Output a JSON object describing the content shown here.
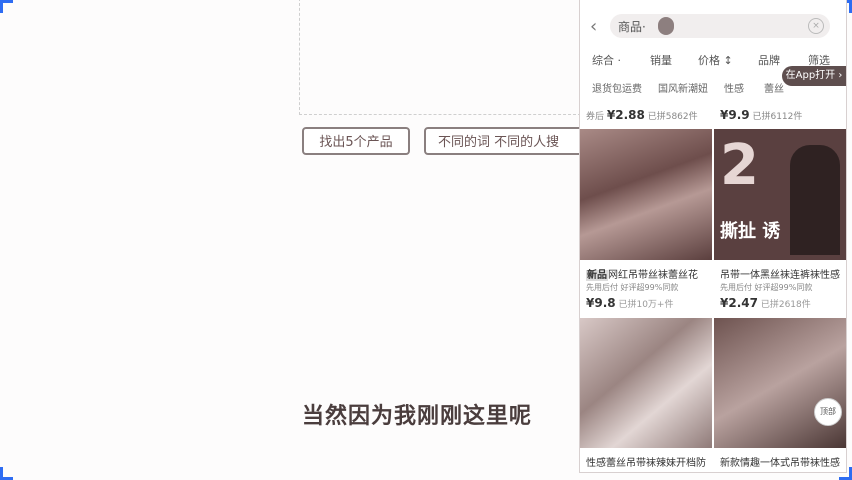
{
  "tags": {
    "t1": "找出5个产品",
    "t2": "不同的词 不同的人搜"
  },
  "subtitle": "当然因为我刚刚这里呢",
  "phone": {
    "category": "商品·",
    "query_chip": "",
    "sort": [
      "综合 ·",
      "销量",
      "价格 ↕",
      "品牌",
      "筛选"
    ],
    "app_open": "在App打开 ›",
    "filters": [
      "退货包运费",
      "国风新潮妞",
      "性感",
      "蕾丝"
    ],
    "prev_row": {
      "left": {
        "label": "券后",
        "price": "¥2.88",
        "sold": "已拼5862件"
      },
      "right": {
        "price": "¥9.9",
        "sold": "已拼6112件"
      }
    },
    "products": [
      {
        "badge": "新品",
        "title": "网红吊带丝袜蕾丝花",
        "note": "先用后付 好评超99%同款",
        "price": "¥9.8",
        "sold": "已拼10万+件"
      },
      {
        "title": "吊带一体黑丝袜连裤袜性感",
        "note": "先用后付 好评超99%同款",
        "price": "¥2.47",
        "sold": "已拼2618件",
        "img_big": "2",
        "img_cap": "撕扯 诱"
      },
      {
        "title": "性感蕾丝吊带袜辣妹开档防"
      },
      {
        "title": "新款情趣一体式吊带袜性感"
      }
    ],
    "float_button": "顶部"
  }
}
